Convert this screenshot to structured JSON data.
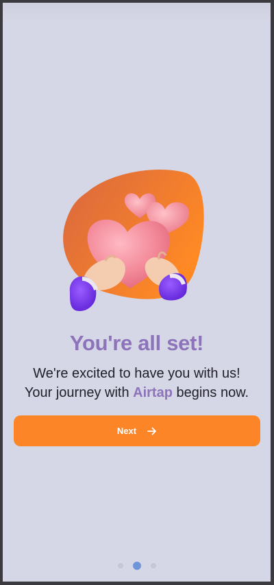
{
  "screen": {
    "title": "You're all set!",
    "subtitle_line1": "We're excited to have you with us!",
    "subtitle_line2_prefix": "Your journey with ",
    "brand_name": "Airtap",
    "subtitle_line2_suffix": " begins now.",
    "illustration": "heart-in-hands-icon"
  },
  "next_button": {
    "label": "Next",
    "icon": "arrow-right-icon"
  },
  "pagination": {
    "total": 3,
    "current": 2
  },
  "colors": {
    "background": "#d6d7e6",
    "accent": "#fb8527",
    "brand": "#8d73b9",
    "active_dot": "#6f95d8"
  }
}
